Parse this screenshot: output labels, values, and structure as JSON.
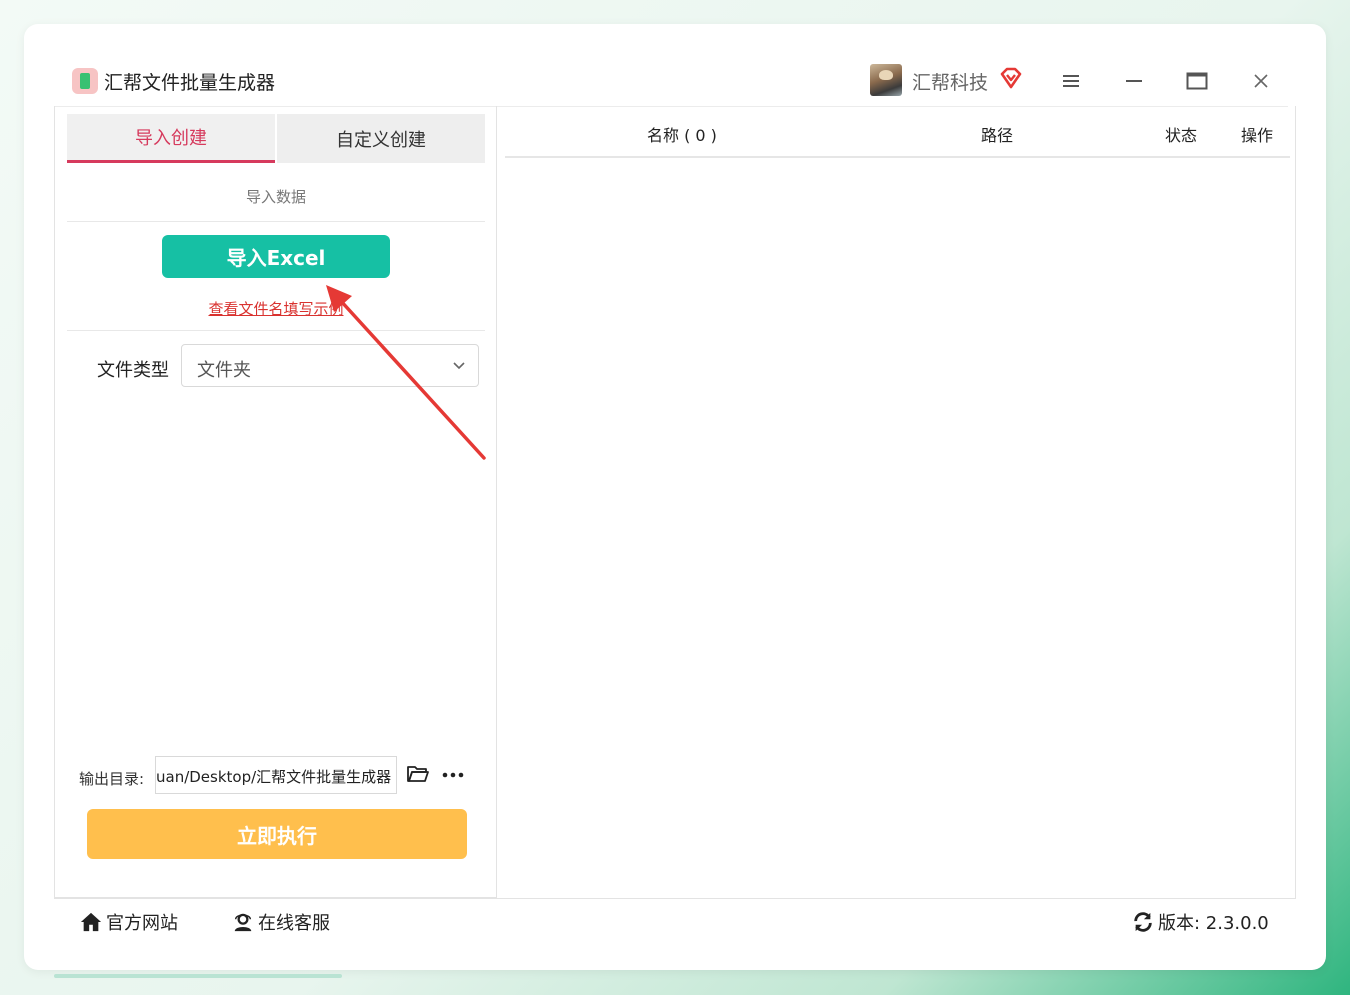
{
  "app": {
    "title": "汇帮文件批量生成器",
    "user_name": "汇帮科技"
  },
  "tabs": [
    {
      "label": "导入创建",
      "active": true
    },
    {
      "label": "自定义创建",
      "active": false
    }
  ],
  "left": {
    "section_label": "导入数据",
    "import_button": "导入Excel",
    "example_link": "查看文件名填写示例",
    "file_type_label": "文件类型",
    "file_type_value": "文件夹",
    "output_label": "输出目录:",
    "output_value": "uan/Desktop/汇帮文件批量生成器",
    "run_button": "立即执行"
  },
  "table": {
    "columns": [
      "名称 ( 0 )",
      "路径",
      "状态",
      "操作"
    ],
    "rows": []
  },
  "footer": {
    "site": "官方网站",
    "service": "在线客服",
    "version": "版本:  2.3.0.0"
  },
  "colors": {
    "accent_tab": "#d63a5d",
    "import_button": "#16c0a4",
    "run_button": "#ffbf4d",
    "link": "#d9322f",
    "annotation_arrow": "#e53935"
  }
}
